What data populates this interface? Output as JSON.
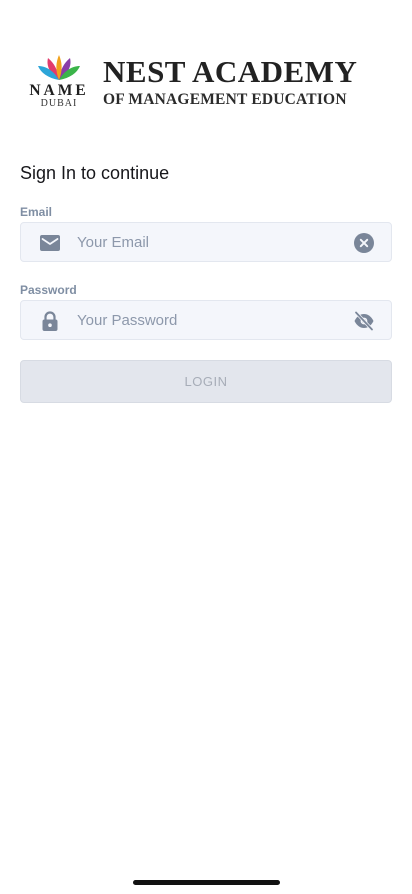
{
  "header": {
    "logo_name": "NAME",
    "logo_city": "DUBAI",
    "title": "NEST ACADEMY",
    "subtitle": "OF MANAGEMENT EDUCATION"
  },
  "form": {
    "heading": "Sign In to continue",
    "email": {
      "label": "Email",
      "placeholder": "Your Email",
      "value": "",
      "leading_icon": "mail-icon",
      "trailing_icon": "clear-icon"
    },
    "password": {
      "label": "Password",
      "placeholder": "Your Password",
      "value": "",
      "leading_icon": "lock-icon",
      "trailing_icon": "eye-off-icon"
    },
    "login_label": "LOGIN"
  },
  "colors": {
    "label": "#7f8ea3",
    "icon": "#7a8699",
    "field_bg": "#f4f6fb",
    "button_bg": "#e3e6ed",
    "button_text": "#a7adb8"
  }
}
